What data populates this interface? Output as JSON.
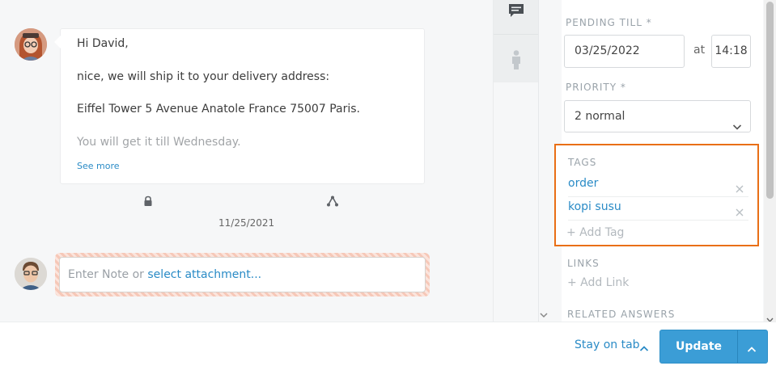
{
  "message": {
    "greeting": "Hi David,",
    "line2": "nice, we will ship it to your delivery address:",
    "line3": "Eiffel Tower 5 Avenue Anatole France 75007 Paris.",
    "line4": "You will get it till Wednesday.",
    "see_more": "See more",
    "date": "11/25/2021"
  },
  "note": {
    "placeholder_prefix": "Enter Note or ",
    "attachment_link": "select attachment..."
  },
  "sidebar": {
    "pending_label": "PENDING TILL *",
    "pending_date": "03/25/2022",
    "at_label": "at",
    "pending_time": "14:18",
    "priority_label": "PRIORITY *",
    "priority_value": "2 normal",
    "tags_label": "TAGS",
    "tags": [
      "order",
      "kopi susu"
    ],
    "add_tag": "+ Add Tag",
    "links_label": "LINKS",
    "add_link": "+ Add Link",
    "related_label": "RELATED ANSWERS"
  },
  "footer": {
    "stay_on_tab": "Stay on tab",
    "update_label": "Update"
  },
  "colors": {
    "accent": "#2a8bc6",
    "highlight": "#e96f16",
    "button": "#3b9dd6"
  }
}
